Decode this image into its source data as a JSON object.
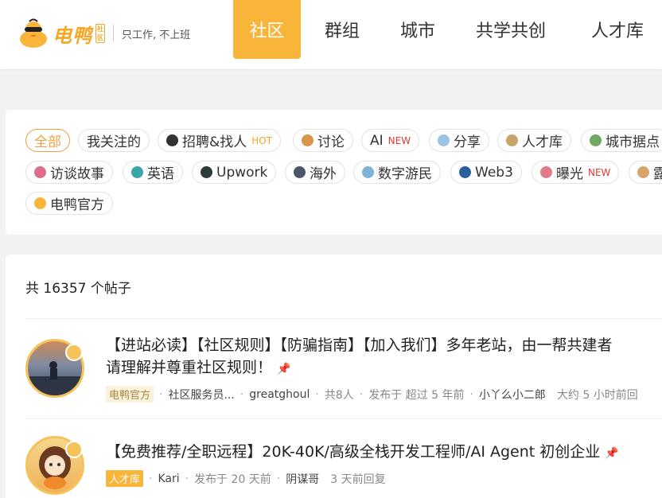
{
  "brand": {
    "name": "电鸭",
    "badge": "社区",
    "slogan": "只工作, 不上班"
  },
  "nav": [
    {
      "label": "社区",
      "active": true
    },
    {
      "label": "群组",
      "active": false
    },
    {
      "label": "城市",
      "active": false
    },
    {
      "label": "共学共创",
      "active": false
    },
    {
      "label": "人才库",
      "active": false
    }
  ],
  "tags": {
    "all": "全部",
    "following": "我关注的",
    "hiring": "招聘&找人",
    "hiring_badge": "HOT",
    "discuss": "讨论",
    "ai": "AI",
    "ai_badge": "NEW",
    "share": "分享",
    "talent": "人才库",
    "city": "城市据点",
    "interview": "访谈故事",
    "english": "英语",
    "upwork": "Upwork",
    "overseas": "海外",
    "nomad": "数字游民",
    "web3": "Web3",
    "expose": "曝光",
    "expose_badge": "NEW",
    "official": "电鸭官方",
    "partial": "露"
  },
  "posts": {
    "count_text": "共 16357 个帖子",
    "items": [
      {
        "title_line1": "【进站必读】【社区规则】【防骗指南】【加入我们】多年老站，由一帮共建者",
        "title_line2": "请理解并尊重社区规则！",
        "label": "电鸭官方",
        "author": "社区服务员...",
        "user2": "greatghoul",
        "people": "共8人",
        "posted": "发布于 超过 5 年前",
        "replier": "小丫么小二郎",
        "replied": "大约 5 小时前回"
      },
      {
        "title_line1": "【免费推荐/全职远程】20K-40K/高级全栈开发工程师/AI Agent 初创企业",
        "label": "人才库",
        "author": "Kari",
        "posted": "发布于 20 天前",
        "replier": "阴谋哥",
        "replied": "3 天前回复"
      }
    ]
  },
  "colors": {
    "accent": "#f9b43a",
    "brand_text": "#f5a623",
    "hot": "#f5a623",
    "new": "#e53935"
  }
}
